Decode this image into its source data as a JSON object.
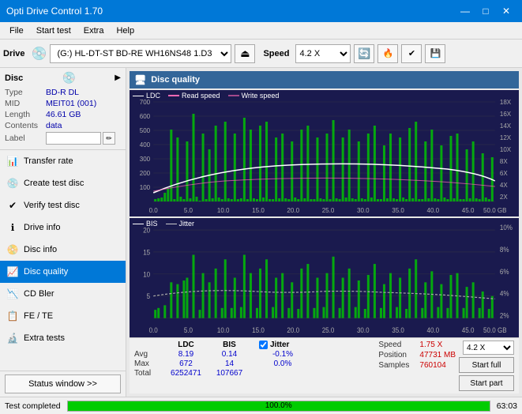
{
  "titlebar": {
    "title": "Opti Drive Control 1.70",
    "minimize": "—",
    "maximize": "□",
    "close": "✕"
  },
  "menubar": {
    "items": [
      "File",
      "Start test",
      "Extra",
      "Help"
    ]
  },
  "toolbar": {
    "drive_label": "Drive",
    "drive_value": "(G:) HL-DT-ST BD-RE  WH16NS48 1.D3",
    "speed_label": "Speed",
    "speed_value": "4.2 X"
  },
  "disc": {
    "title": "Disc",
    "type_label": "Type",
    "type_value": "BD-R DL",
    "mid_label": "MID",
    "mid_value": "MEIT01 (001)",
    "length_label": "Length",
    "length_value": "46.61 GB",
    "contents_label": "Contents",
    "contents_value": "data",
    "label_label": "Label",
    "label_value": ""
  },
  "nav": {
    "items": [
      {
        "id": "transfer-rate",
        "label": "Transfer rate",
        "icon": "📊"
      },
      {
        "id": "create-test-disc",
        "label": "Create test disc",
        "icon": "💿"
      },
      {
        "id": "verify-test-disc",
        "label": "Verify test disc",
        "icon": "✔"
      },
      {
        "id": "drive-info",
        "label": "Drive info",
        "icon": "ℹ"
      },
      {
        "id": "disc-info",
        "label": "Disc info",
        "icon": "📀"
      },
      {
        "id": "disc-quality",
        "label": "Disc quality",
        "icon": "📈",
        "active": true
      },
      {
        "id": "cd-bler",
        "label": "CD Bler",
        "icon": "📉"
      },
      {
        "id": "fe-te",
        "label": "FE / TE",
        "icon": "📋"
      },
      {
        "id": "extra-tests",
        "label": "Extra tests",
        "icon": "🔬"
      }
    ],
    "status_btn": "Status window >>"
  },
  "disc_quality": {
    "title": "Disc quality",
    "chart1": {
      "legend": [
        "LDC",
        "Read speed",
        "Write speed"
      ],
      "y_max": 700,
      "y_right_max": 18,
      "x_max": 50
    },
    "chart2": {
      "legend": [
        "BIS",
        "Jitter"
      ],
      "y_max": 20,
      "y_right_max": 10,
      "x_max": 50
    }
  },
  "stats": {
    "headers": [
      "",
      "LDC",
      "BIS",
      "",
      "Jitter",
      "Speed",
      ""
    ],
    "avg_label": "Avg",
    "avg_ldc": "8.19",
    "avg_bis": "0.14",
    "avg_jitter": "-0.1%",
    "max_label": "Max",
    "max_ldc": "672",
    "max_bis": "14",
    "max_jitter": "0.0%",
    "total_label": "Total",
    "total_ldc": "6252471",
    "total_bis": "107667",
    "speed_label": "Speed",
    "speed_value": "1.75 X",
    "position_label": "Position",
    "position_value": "47731 MB",
    "samples_label": "Samples",
    "samples_value": "760104",
    "jitter_checked": true,
    "speed_select": "4.2 X",
    "start_full": "Start full",
    "start_part": "Start part"
  },
  "statusbar": {
    "text": "Test completed",
    "progress": 100,
    "time": "63:03"
  }
}
